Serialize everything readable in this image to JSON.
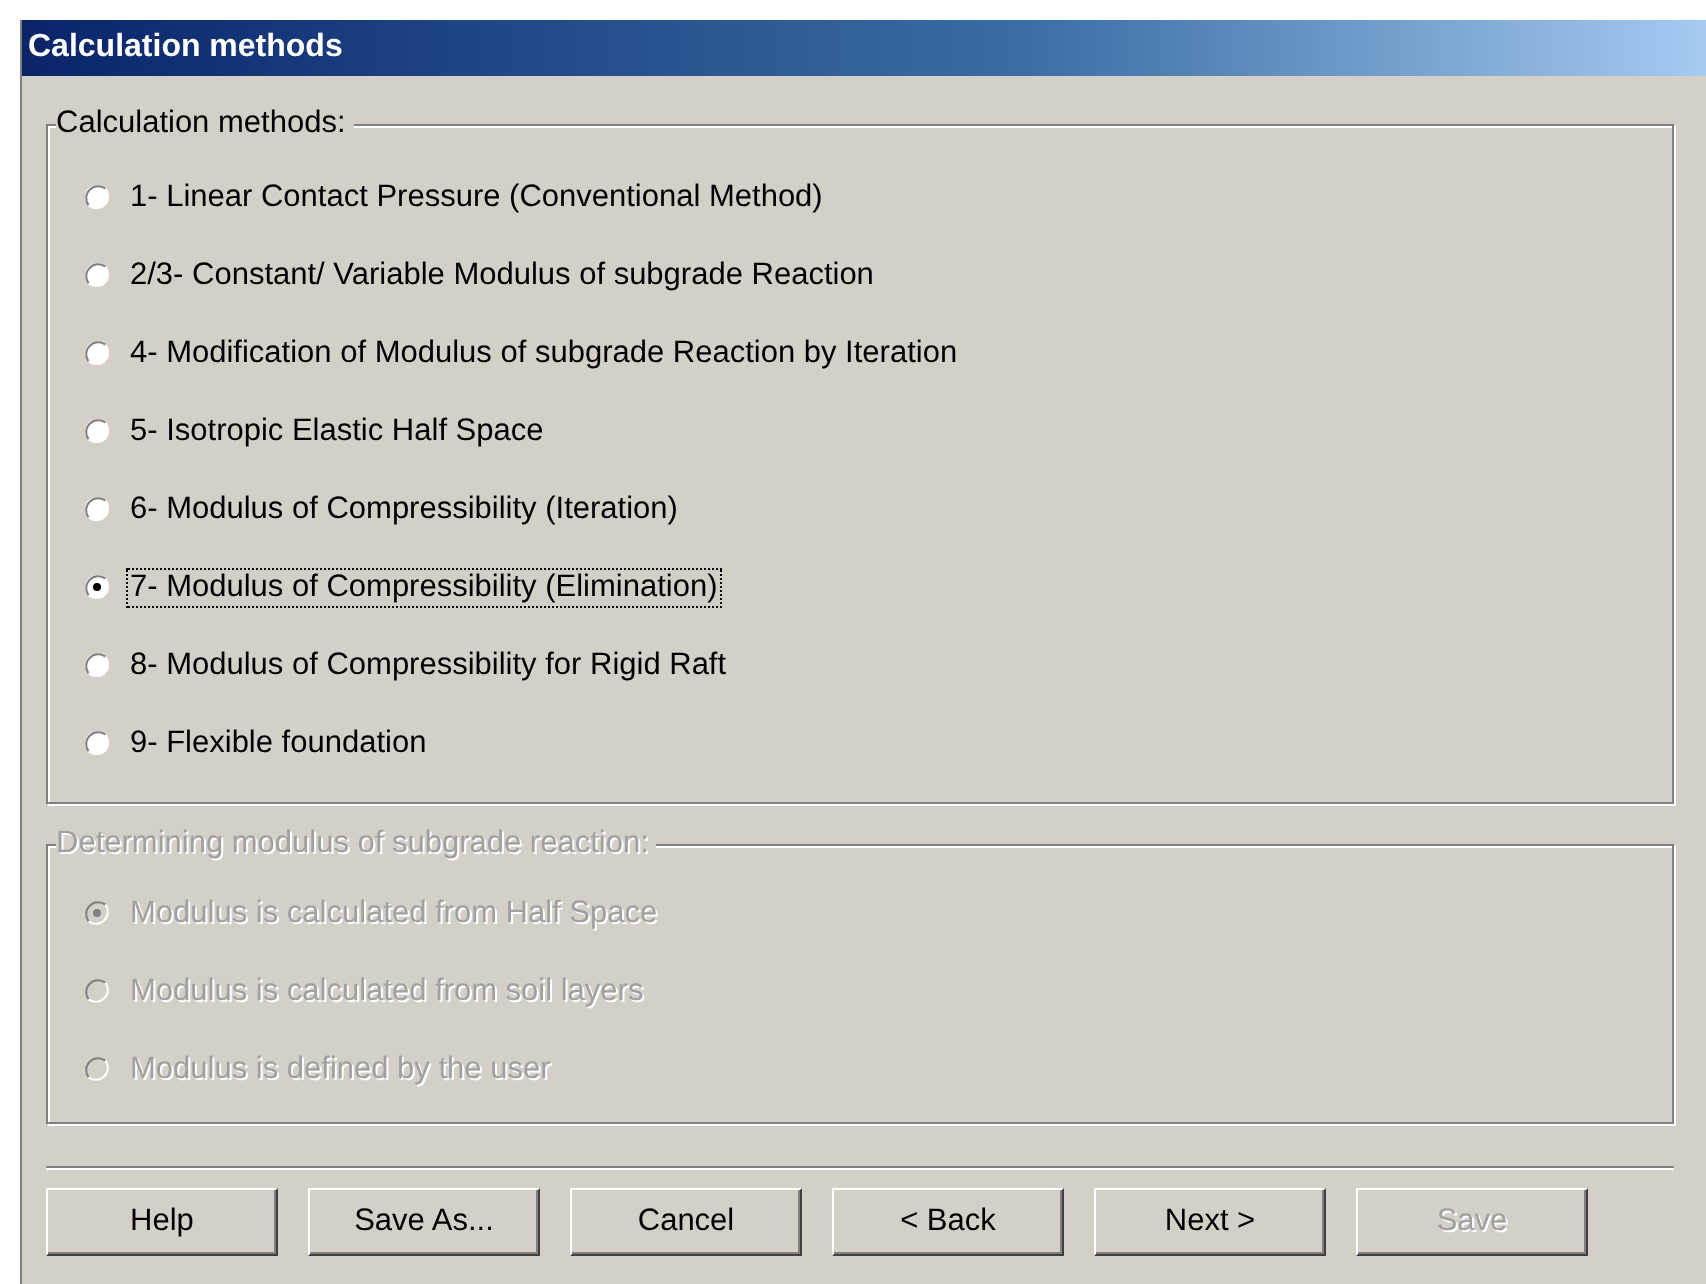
{
  "window": {
    "title": "Calculation methods"
  },
  "methods_group": {
    "label": "Calculation methods:",
    "disabled": false,
    "options": [
      {
        "label": "1- Linear Contact Pressure (Conventional Method)",
        "selected": false,
        "focused": false
      },
      {
        "label": "2/3- Constant/ Variable Modulus of subgrade Reaction",
        "selected": false,
        "focused": false
      },
      {
        "label": "4- Modification of Modulus of subgrade Reaction by Iteration",
        "selected": false,
        "focused": false
      },
      {
        "label": "5- Isotropic Elastic Half Space",
        "selected": false,
        "focused": false
      },
      {
        "label": "6- Modulus of Compressibility (Iteration)",
        "selected": false,
        "focused": false
      },
      {
        "label": "7- Modulus of Compressibility (Elimination)",
        "selected": true,
        "focused": true
      },
      {
        "label": "8- Modulus of Compressibility for Rigid Raft",
        "selected": false,
        "focused": false
      },
      {
        "label": "9- Flexible foundation",
        "selected": false,
        "focused": false
      }
    ]
  },
  "subgrade_group": {
    "label": "Determining modulus of subgrade reaction:",
    "disabled": true,
    "options": [
      {
        "label": "Modulus is calculated from Half Space",
        "selected": true,
        "focused": false
      },
      {
        "label": "Modulus is calculated from soil layers",
        "selected": false,
        "focused": false
      },
      {
        "label": "Modulus is defined by the user",
        "selected": false,
        "focused": false
      }
    ]
  },
  "buttons": [
    {
      "label": "Help",
      "disabled": false
    },
    {
      "label": "Save As...",
      "disabled": false
    },
    {
      "label": "Cancel",
      "disabled": false
    },
    {
      "label": "< Back",
      "disabled": false
    },
    {
      "label": "Next >",
      "disabled": false
    },
    {
      "label": "Save",
      "disabled": true
    }
  ]
}
